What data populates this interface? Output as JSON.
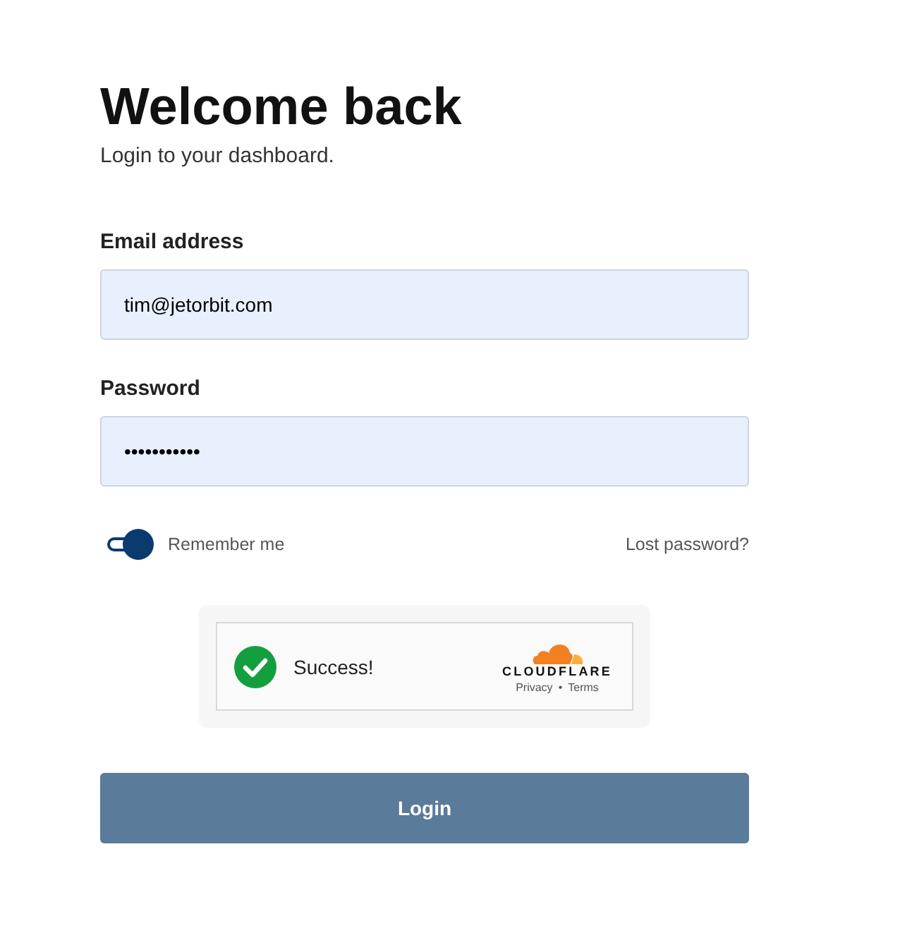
{
  "heading": "Welcome back",
  "subtitle": "Login to your dashboard.",
  "fields": [
    {
      "label": "Email address",
      "value": "tim@jetorbit.com"
    },
    {
      "label": "Password",
      "value": "•••••••••••"
    }
  ],
  "remember": {
    "label": "Remember me",
    "on": true
  },
  "lost_password": "Lost password?",
  "captcha": {
    "status": "Success!",
    "brand": "CLOUDFLARE",
    "links": [
      "Privacy",
      "Terms"
    ],
    "separator": "•"
  },
  "login_button": "Login"
}
